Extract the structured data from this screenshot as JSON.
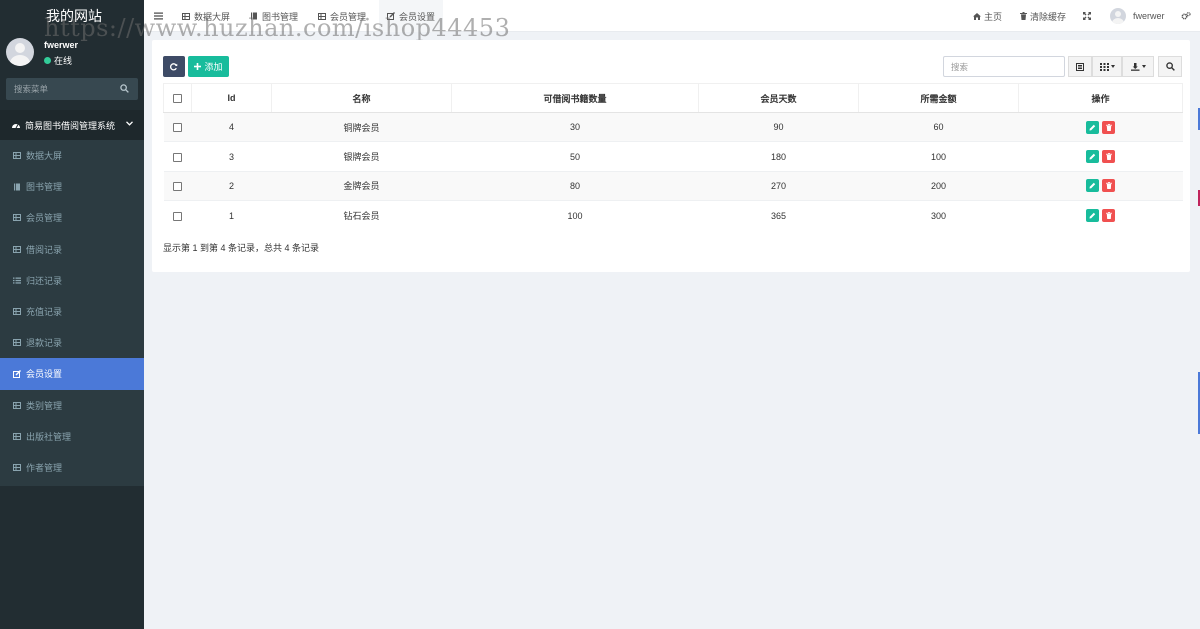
{
  "watermark": "https://www.huzhan.com/ishop44453",
  "sidebar": {
    "brand": "我的网站",
    "user": {
      "name": "fwerwer",
      "status": "在线"
    },
    "search_placeholder": "搜索菜单",
    "menu_header": "简易图书借阅管理系统",
    "items": [
      {
        "label": "数据大屏",
        "icon": "table-icon"
      },
      {
        "label": "图书管理",
        "icon": "book-icon"
      },
      {
        "label": "会员管理",
        "icon": "table-icon"
      },
      {
        "label": "借阅记录",
        "icon": "table-icon"
      },
      {
        "label": "归还记录",
        "icon": "list-icon"
      },
      {
        "label": "充值记录",
        "icon": "table-icon"
      },
      {
        "label": "退款记录",
        "icon": "table-icon"
      },
      {
        "label": "会员设置",
        "icon": "edit-icon",
        "active": true
      },
      {
        "label": "类别管理",
        "icon": "table-icon"
      },
      {
        "label": "出版社管理",
        "icon": "table-icon"
      },
      {
        "label": "作者管理",
        "icon": "table-icon"
      }
    ]
  },
  "topbar": {
    "tabs": [
      {
        "label": "数据大屏",
        "icon": "table-icon"
      },
      {
        "label": "图书管理",
        "icon": "book-icon"
      },
      {
        "label": "会员管理",
        "icon": "table-icon"
      },
      {
        "label": "会员设置",
        "icon": "edit-icon",
        "active": true
      }
    ],
    "home": "主页",
    "clear_cache": "清除缓存",
    "username": "fwerwer"
  },
  "toolbar": {
    "add_label": "添加",
    "search_placeholder": "搜索"
  },
  "table": {
    "columns": [
      "Id",
      "名称",
      "可借阅书籍数量",
      "会员天数",
      "所需金额",
      "操作"
    ],
    "rows": [
      {
        "id": "4",
        "name": "铜牌会员",
        "books": "30",
        "days": "90",
        "amount": "60"
      },
      {
        "id": "3",
        "name": "银牌会员",
        "books": "50",
        "days": "180",
        "amount": "100"
      },
      {
        "id": "2",
        "name": "金牌会员",
        "books": "80",
        "days": "270",
        "amount": "200"
      },
      {
        "id": "1",
        "name": "钻石会员",
        "books": "100",
        "days": "365",
        "amount": "300"
      }
    ]
  },
  "pager": {
    "info": "显示第 1 到第 4 条记录，总共 4 条记录"
  },
  "colors": {
    "sidebar_bg": "#222d32",
    "active": "#4b79d8",
    "add": "#18bc9c",
    "refresh": "#3e4b66",
    "delete": "#f05050"
  }
}
